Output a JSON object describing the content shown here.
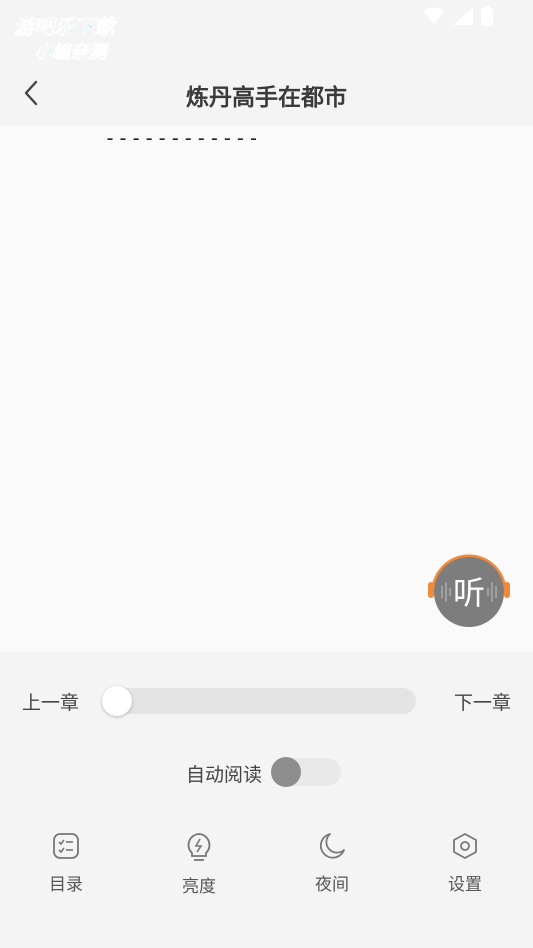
{
  "watermark": {
    "line1": "游吧乐下载",
    "line2": "小编亲测"
  },
  "header": {
    "title": "炼丹高手在都市"
  },
  "content": {
    "divider": "------------"
  },
  "listen_button": {
    "label": "听"
  },
  "controls": {
    "prev_label": "上一章",
    "next_label": "下一章",
    "progress": 0.0,
    "auto_read_label": "自动阅读",
    "auto_read_on": false
  },
  "nav": [
    {
      "label": "目录",
      "icon": "catalog-icon"
    },
    {
      "label": "亮度",
      "icon": "brightness-icon"
    },
    {
      "label": "夜间",
      "icon": "moon-icon"
    },
    {
      "label": "设置",
      "icon": "settings-icon"
    }
  ],
  "colors": {
    "accent": "#f08a3a",
    "listen_bg": "#7d7d7d"
  }
}
